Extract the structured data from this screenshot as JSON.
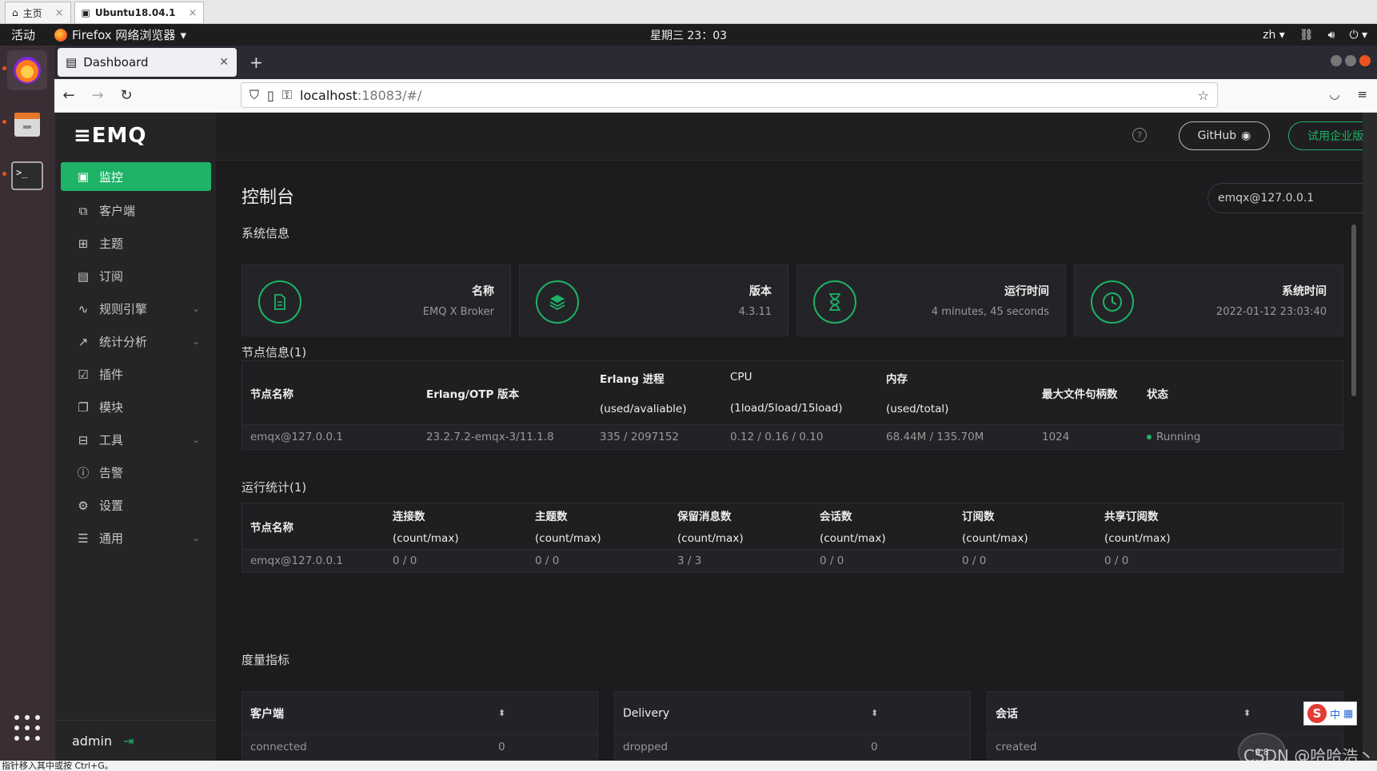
{
  "vm_tabs": [
    {
      "label": "主页"
    },
    {
      "label": "Ubuntu18.04.1"
    }
  ],
  "gnome": {
    "activities": "活动",
    "app_name": "Firefox 网络浏览器",
    "clock": "星期三 23：03",
    "lang": "zh"
  },
  "browser": {
    "tab_title": "Dashboard",
    "url_host": "localhost",
    "url_path": ":18083/#/"
  },
  "app": {
    "logo": "EMQ",
    "user": "admin",
    "github_label": "GitHub",
    "trial_label": "试用企业版",
    "accent": "#1eb366"
  },
  "sidebar": {
    "items": [
      {
        "label": "监控",
        "icon": "monitor-icon",
        "active": true
      },
      {
        "label": "客户端",
        "icon": "clients-icon"
      },
      {
        "label": "主题",
        "icon": "topics-icon"
      },
      {
        "label": "订阅",
        "icon": "subscriptions-icon"
      },
      {
        "label": "规则引擎",
        "icon": "rules-icon",
        "expandable": true
      },
      {
        "label": "统计分析",
        "icon": "analytics-icon",
        "expandable": true
      },
      {
        "label": "插件",
        "icon": "plugins-icon"
      },
      {
        "label": "模块",
        "icon": "modules-icon"
      },
      {
        "label": "工具",
        "icon": "tools-icon",
        "expandable": true
      },
      {
        "label": "告警",
        "icon": "alarm-icon"
      },
      {
        "label": "设置",
        "icon": "settings-icon"
      },
      {
        "label": "通用",
        "icon": "general-icon",
        "expandable": true
      }
    ]
  },
  "main": {
    "title": "控制台",
    "node_select": "emqx@127.0.0.1",
    "system_info_title": "系统信息",
    "cards": [
      {
        "label": "名称",
        "value": "EMQ X Broker",
        "icon": "document-icon"
      },
      {
        "label": "版本",
        "value": "4.3.11",
        "icon": "layers-icon"
      },
      {
        "label": "运行时间",
        "value": "4 minutes, 45 seconds",
        "icon": "hourglass-icon"
      },
      {
        "label": "系统时间",
        "value": "2022-01-12 23:03:40",
        "icon": "clock-icon"
      }
    ],
    "nodes_title": "节点信息(1)",
    "nodes_headers": {
      "name": "节点名称",
      "otp": "Erlang/OTP 版本",
      "erlang": "Erlang 进程",
      "erlang_sub": "(used/avaliable)",
      "cpu": "CPU",
      "cpu_sub": "(1load/5load/15load)",
      "mem": "内存",
      "mem_sub": "(used/total)",
      "fd": "最大文件句柄数",
      "status": "状态"
    },
    "nodes_row": {
      "name": "emqx@127.0.0.1",
      "otp": "23.2.7.2-emqx-3/11.1.8",
      "erlang": "335 / 2097152",
      "cpu": "0.12 / 0.16 / 0.10",
      "mem": "68.44M / 135.70M",
      "fd": "1024",
      "status": "Running"
    },
    "stats_title": "运行统计(1)",
    "stats_headers": {
      "name": "节点名称",
      "conn": "连接数",
      "topics": "主题数",
      "retained": "保留消息数",
      "sessions": "会话数",
      "subs": "订阅数",
      "shared": "共享订阅数",
      "sub": "(count/max)"
    },
    "stats_row": {
      "name": "emqx@127.0.0.1",
      "conn": "0 / 0",
      "topics": "0 / 0",
      "retained": "3 / 3",
      "sessions": "0 / 0",
      "subs": "0 / 0",
      "shared": "0 / 0"
    },
    "metrics_title": "度量指标",
    "metrics": [
      {
        "header": "客户端",
        "row_label": "connected",
        "row_value": "0"
      },
      {
        "header": "Delivery",
        "row_label": "dropped",
        "row_value": "0"
      },
      {
        "header": "会话",
        "row_label": "created",
        "row_value": ""
      }
    ]
  },
  "overlay": {
    "ime_label": "中",
    "watermark": "CSDN @哈哈浩丶",
    "net_speed": "9.8",
    "status_text": "指针移入其中或按 Ctrl+G。"
  }
}
